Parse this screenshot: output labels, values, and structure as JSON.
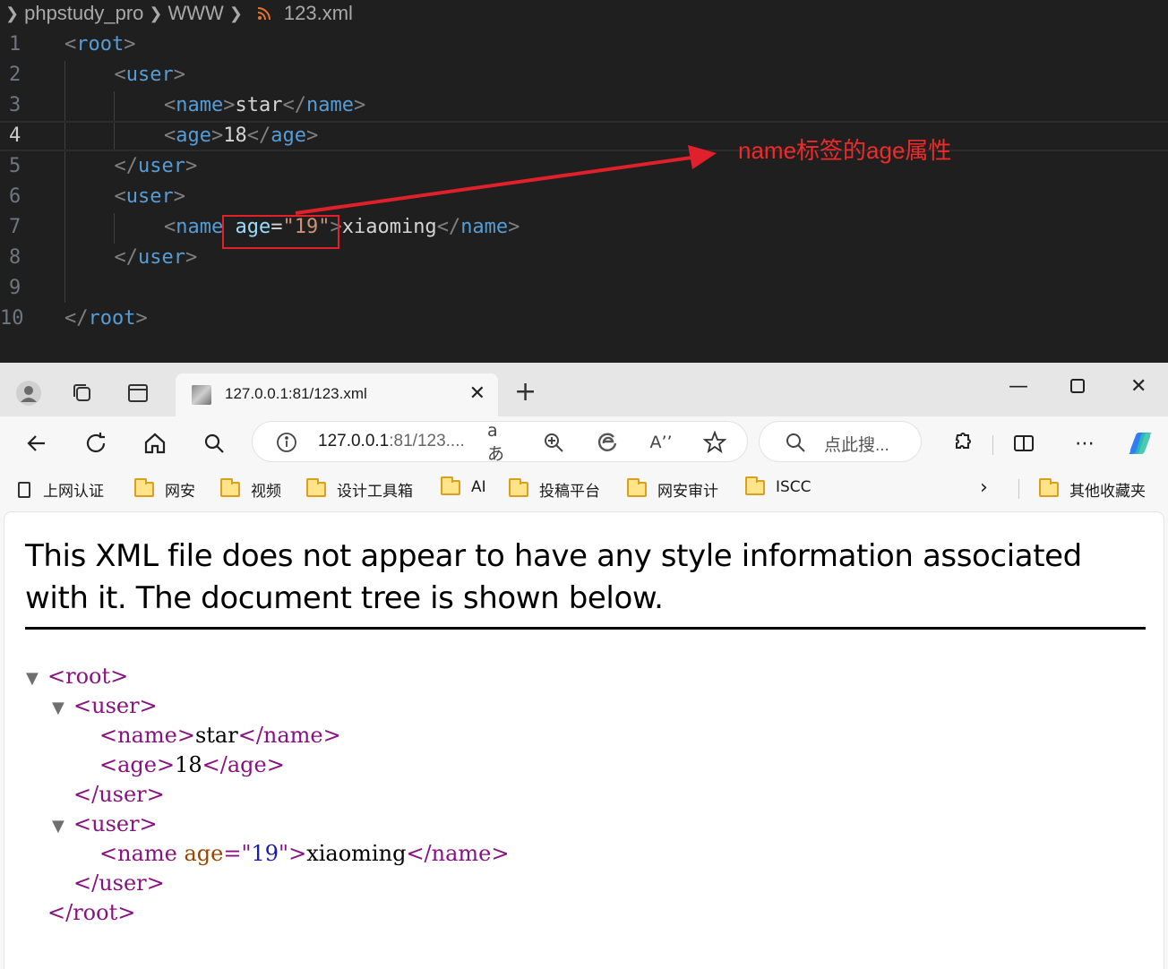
{
  "editor": {
    "breadcrumb": [
      "phpstudy_pro",
      "WWW",
      "123.xml"
    ],
    "lines": [
      {
        "n": "1",
        "indent": 0,
        "parts": [
          [
            "br",
            "<"
          ],
          [
            "tg",
            "root"
          ],
          [
            "br",
            ">"
          ]
        ]
      },
      {
        "n": "2",
        "indent": 1,
        "parts": [
          [
            "br",
            "<"
          ],
          [
            "tg",
            "user"
          ],
          [
            "br",
            ">"
          ]
        ]
      },
      {
        "n": "3",
        "indent": 2,
        "parts": [
          [
            "br",
            "<"
          ],
          [
            "tg",
            "name"
          ],
          [
            "br",
            ">"
          ],
          [
            "tx",
            "star"
          ],
          [
            "br",
            "</"
          ],
          [
            "tg",
            "name"
          ],
          [
            "br",
            ">"
          ]
        ]
      },
      {
        "n": "4",
        "indent": 2,
        "parts": [
          [
            "br",
            "<"
          ],
          [
            "tg",
            "age"
          ],
          [
            "br",
            ">"
          ],
          [
            "tx",
            "18"
          ],
          [
            "br",
            "</"
          ],
          [
            "tg",
            "age"
          ],
          [
            "br",
            ">"
          ]
        ]
      },
      {
        "n": "5",
        "indent": 1,
        "parts": [
          [
            "br",
            "</"
          ],
          [
            "tg",
            "user"
          ],
          [
            "br",
            ">"
          ]
        ]
      },
      {
        "n": "6",
        "indent": 1,
        "parts": [
          [
            "br",
            "<"
          ],
          [
            "tg",
            "user"
          ],
          [
            "br",
            ">"
          ]
        ]
      },
      {
        "n": "7",
        "indent": 2,
        "parts": [
          [
            "br",
            "<"
          ],
          [
            "tg",
            "name"
          ],
          [
            "tx",
            " "
          ],
          [
            "at",
            "age"
          ],
          [
            "tx",
            "="
          ],
          [
            "st",
            "\"19\""
          ],
          [
            "br",
            ">"
          ],
          [
            "tx",
            "xiaoming"
          ],
          [
            "br",
            "</"
          ],
          [
            "tg",
            "name"
          ],
          [
            "br",
            ">"
          ]
        ]
      },
      {
        "n": "8",
        "indent": 1,
        "parts": [
          [
            "br",
            "</"
          ],
          [
            "tg",
            "user"
          ],
          [
            "br",
            ">"
          ]
        ]
      },
      {
        "n": "9",
        "indent": 0,
        "parts": []
      },
      {
        "n": "10",
        "indent": 0,
        "parts": [
          [
            "br",
            "</"
          ],
          [
            "tg",
            "root"
          ],
          [
            "br",
            ">"
          ]
        ]
      }
    ],
    "active_line": "4",
    "annotation": "name标签的age属性"
  },
  "browser": {
    "tab_title": "127.0.0.1:81/123.xml",
    "address": {
      "host": "127.0.0.1",
      "rest": ":81/123...."
    },
    "search_placeholder": "点此搜...",
    "bookmarks": [
      {
        "label": "上网认证",
        "kind": "page"
      },
      {
        "label": "网安",
        "kind": "folder"
      },
      {
        "label": "视频",
        "kind": "folder"
      },
      {
        "label": "设计工具箱",
        "kind": "folder"
      },
      {
        "label": "AI",
        "kind": "folder"
      },
      {
        "label": "投稿平台",
        "kind": "folder"
      },
      {
        "label": "网安审计",
        "kind": "folder"
      },
      {
        "label": "ISCC",
        "kind": "folder"
      }
    ],
    "other_bookmarks": "其他收藏夹",
    "info_text": "This XML file does not appear to have any style information associated with it. The document tree is shown below.",
    "xml_tree": [
      {
        "toggle": true,
        "indent": 0,
        "parts": [
          [
            "xt",
            "<root>"
          ]
        ]
      },
      {
        "toggle": true,
        "indent": 1,
        "parts": [
          [
            "xt",
            "<user>"
          ]
        ]
      },
      {
        "toggle": false,
        "indent": 2,
        "parts": [
          [
            "xt",
            "<name>"
          ],
          [
            "xx",
            "star"
          ],
          [
            "xt",
            "</name>"
          ]
        ]
      },
      {
        "toggle": false,
        "indent": 2,
        "parts": [
          [
            "xt",
            "<age>"
          ],
          [
            "xx",
            "18"
          ],
          [
            "xt",
            "</age>"
          ]
        ]
      },
      {
        "toggle": false,
        "indent": 1,
        "parts": [
          [
            "xt",
            "</user>"
          ]
        ]
      },
      {
        "toggle": true,
        "indent": 1,
        "parts": [
          [
            "xt",
            "<user>"
          ]
        ]
      },
      {
        "toggle": false,
        "indent": 2,
        "parts": [
          [
            "xt",
            "<name "
          ],
          [
            "xa",
            "age"
          ],
          [
            "xt",
            "=\""
          ],
          [
            "xv",
            "19"
          ],
          [
            "xt",
            "\">"
          ],
          [
            "xx",
            "xiaoming"
          ],
          [
            "xt",
            "</name>"
          ]
        ]
      },
      {
        "toggle": false,
        "indent": 1,
        "parts": [
          [
            "xt",
            "</user>"
          ]
        ]
      },
      {
        "toggle": false,
        "indent": 0,
        "parts": [
          [
            "xt",
            "</root>"
          ]
        ]
      }
    ]
  }
}
